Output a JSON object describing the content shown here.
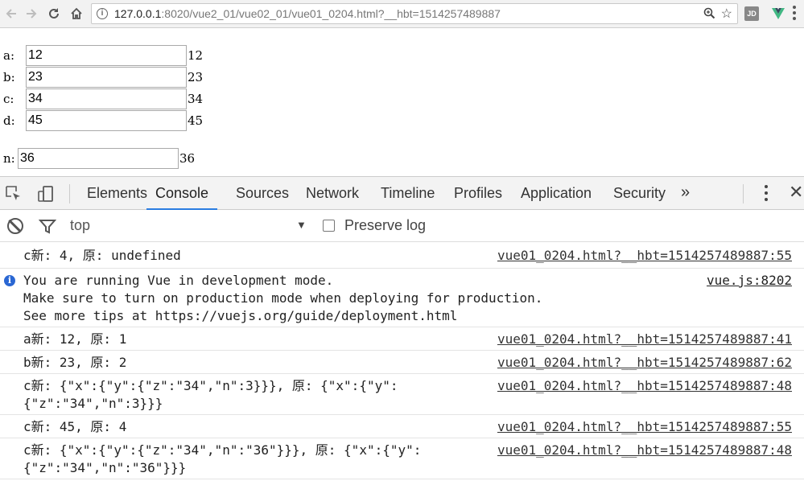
{
  "browser": {
    "url_host": "127.0.0.1",
    "url_rest": ":8020/vue2_01/vue02_01/vue01_0204.html?__hbt=1514257489887",
    "ext_jd": "JD"
  },
  "page": {
    "rows": [
      {
        "label": "a:",
        "value": "12",
        "output": "12"
      },
      {
        "label": "b:",
        "value": "23",
        "output": "23"
      },
      {
        "label": "c:",
        "value": "34",
        "output": "34"
      },
      {
        "label": "d:",
        "value": "45",
        "output": "45"
      }
    ],
    "n": {
      "label": "n:",
      "value": "36",
      "output": "36"
    }
  },
  "devtools": {
    "tabs": [
      "Elements",
      "Console",
      "Sources",
      "Network",
      "Timeline",
      "Profiles",
      "Application",
      "Security"
    ],
    "active_tab": "Console",
    "more": "»",
    "context": "top",
    "preserve_log": "Preserve log",
    "accent": "#2a7de1"
  },
  "console": {
    "messages": [
      {
        "text": "c新: 4, 原: undefined",
        "source": "vue01_0204.html?__hbt=1514257489887:55"
      },
      {
        "type": "info",
        "text": "You are running Vue in development mode.\nMake sure to turn on production mode when deploying for production.\nSee more tips at https://vuejs.org/guide/deployment.html",
        "source": "vue.js:8202"
      },
      {
        "text": "a新: 12, 原: 1",
        "source": "vue01_0204.html?__hbt=1514257489887:41"
      },
      {
        "text": "b新: 23, 原: 2",
        "source": "vue01_0204.html?__hbt=1514257489887:62"
      },
      {
        "text": "c新: {\"x\":{\"y\":{\"z\":\"34\",\"n\":3}}}, 原: {\"x\":{\"y\":\n{\"z\":\"34\",\"n\":3}}}",
        "source": "vue01_0204.html?__hbt=1514257489887:48"
      },
      {
        "text": "c新: 45, 原: 4",
        "source": "vue01_0204.html?__hbt=1514257489887:55"
      },
      {
        "text": "c新: {\"x\":{\"y\":{\"z\":\"34\",\"n\":\"36\"}}}, 原: {\"x\":{\"y\":\n{\"z\":\"34\",\"n\":\"36\"}}}",
        "source": "vue01_0204.html?__hbt=1514257489887:48"
      }
    ]
  }
}
